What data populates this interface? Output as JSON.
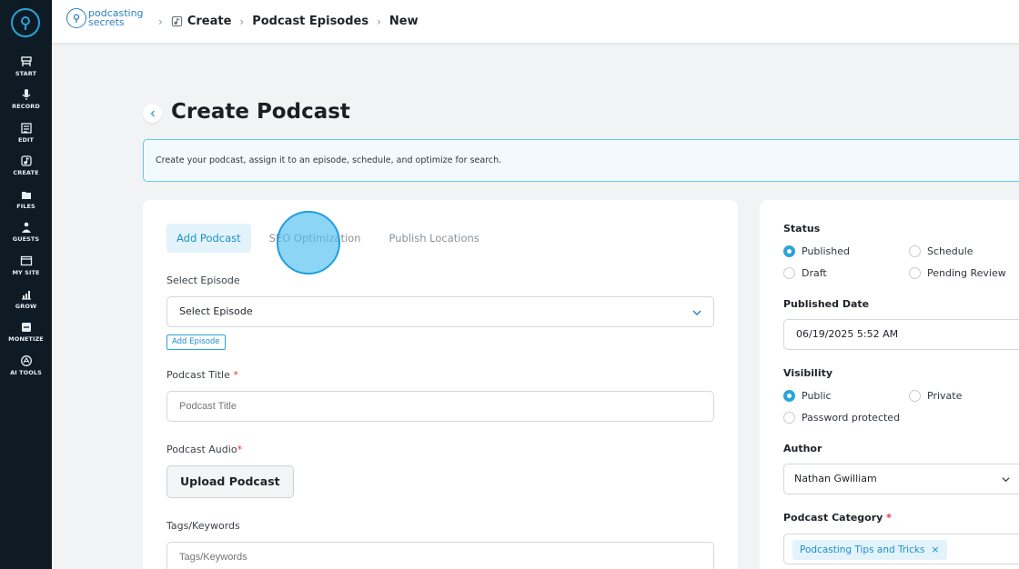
{
  "sidebar": {
    "items": [
      {
        "label": "START",
        "icon": "start-icon"
      },
      {
        "label": "RECORD",
        "icon": "microphone-icon"
      },
      {
        "label": "EDIT",
        "icon": "edit-icon"
      },
      {
        "label": "CREATE",
        "icon": "create-icon"
      },
      {
        "label": "FILES",
        "icon": "files-icon"
      },
      {
        "label": "GUESTS",
        "icon": "guests-icon"
      },
      {
        "label": "MY SITE",
        "icon": "site-icon"
      },
      {
        "label": "GROW",
        "icon": "grow-icon"
      },
      {
        "label": "MONETIZE",
        "icon": "monetize-icon"
      },
      {
        "label": "AI TOOLS",
        "icon": "ai-tools-icon"
      }
    ]
  },
  "header": {
    "brand_line1": "podcasting",
    "brand_line2": "secrets",
    "breadcrumb": [
      "Create",
      "Podcast Episodes",
      "New"
    ]
  },
  "page": {
    "title": "Create Podcast",
    "info": "Create your podcast, assign it to an episode, schedule, and optimize for search."
  },
  "form": {
    "tabs": [
      "Add Podcast",
      "SEO Optimization",
      "Publish Locations"
    ],
    "active_tab": "Add Podcast",
    "select_episode_label": "Select Episode",
    "select_episode_value": "Select Episode",
    "add_episode_label": "Add Episode",
    "podcast_title_label": "Podcast Title",
    "podcast_title_placeholder": "Podcast Title",
    "podcast_audio_label": "Podcast Audio",
    "upload_label": "Upload Podcast",
    "tags_label": "Tags/Keywords",
    "tags_placeholder": "Tags/Keywords",
    "required_mark": "*"
  },
  "panel": {
    "status_label": "Status",
    "status_options": [
      "Published",
      "Schedule",
      "Draft",
      "Pending Review"
    ],
    "status_selected": "Published",
    "published_date_label": "Published Date",
    "published_date_value": "06/19/2025 5:52 AM",
    "visibility_label": "Visibility",
    "visibility_options": [
      "Public",
      "Private",
      "Password protected"
    ],
    "visibility_selected": "Public",
    "author_label": "Author",
    "author_value": "Nathan Gwilliam",
    "category_label": "Podcast Category",
    "category_chip": "Podcasting Tips and Tricks"
  },
  "colors": {
    "sidebar_bg": "#0e1b24",
    "accent": "#2aa4d9",
    "required": "#e2353b"
  }
}
